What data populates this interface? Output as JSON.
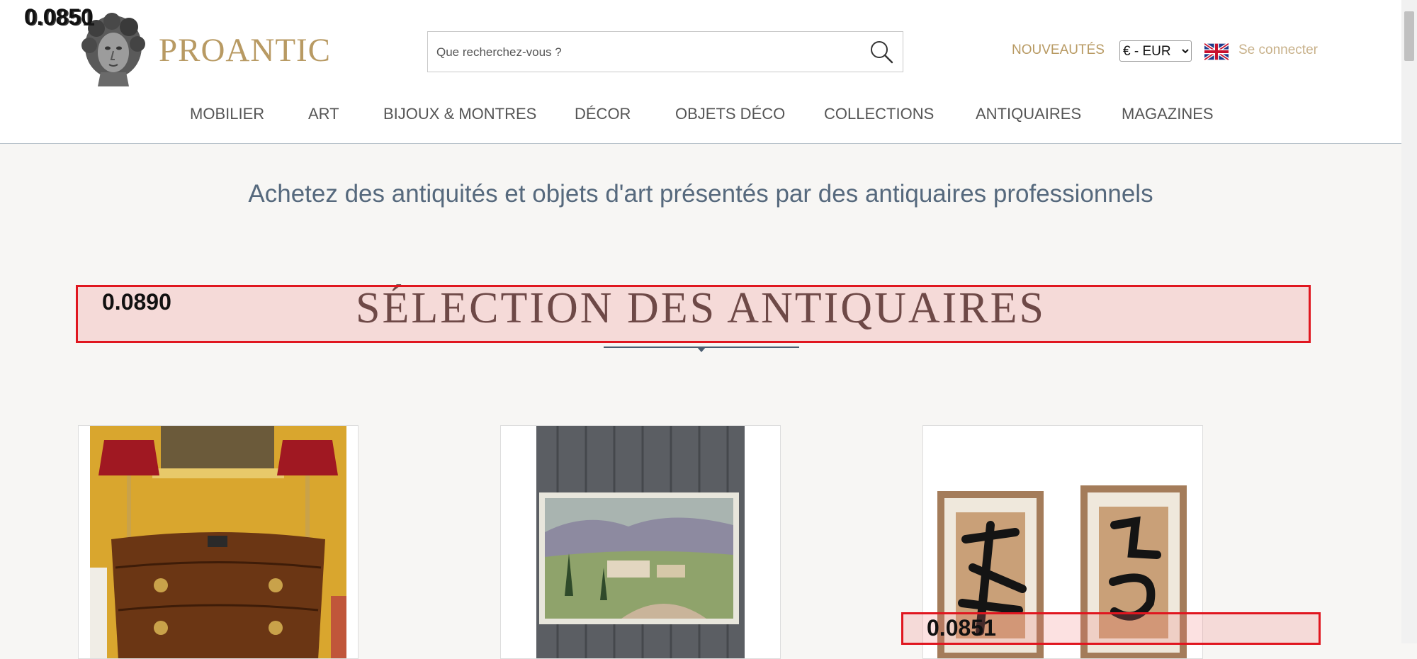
{
  "header": {
    "brand": "PROANTIC",
    "search_placeholder": "Que recherchez-vous ?",
    "new_label": "NOUVEAUTÉS",
    "currency": "€ - EUR",
    "currency_options": [
      "€ - EUR"
    ],
    "login_label": "Se connecter"
  },
  "nav": [
    "MOBILIER",
    "ART",
    "BIJOUX & MONTRES",
    "DÉCOR",
    "OBJETS DÉCO",
    "COLLECTIONS",
    "ANTIQUAIRES",
    "MAGAZINES"
  ],
  "tagline": "Achetez des antiquités et objets d'art présentés par des antiquaires professionnels",
  "selection": {
    "title": "SÉLECTION DES ANTIQUAIRES"
  },
  "overlay_scores": {
    "logo_score": "0.0850",
    "logo_score_overlap": "0.0851",
    "title_score": "0.0890",
    "card_score": "0.0851"
  },
  "icons": {
    "search": "magnifier-icon",
    "flag": "uk-flag-icon",
    "logo": "bust-logo-icon"
  },
  "colors": {
    "brand_gold": "#b89a63",
    "tagline_blue": "#56697d",
    "highlight_red": "#e0161f"
  }
}
